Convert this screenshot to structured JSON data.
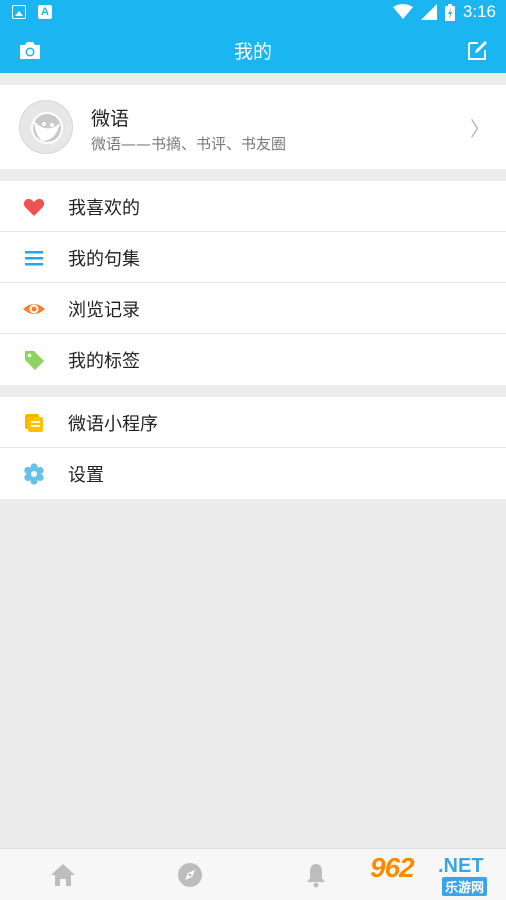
{
  "status_bar": {
    "time": "3:16"
  },
  "app_bar": {
    "title": "我的",
    "left_icon": "camera-icon",
    "right_icon": "edit-icon"
  },
  "profile": {
    "name": "微语",
    "description": "微语——书摘、书评、书友圈",
    "chevron": "〉"
  },
  "menu_group_1": {
    "items": [
      {
        "label": "我喜欢的",
        "icon": "heart-icon",
        "color": "#ef5350"
      },
      {
        "label": "我的句集",
        "icon": "list-icon",
        "color": "#1aa9ee"
      },
      {
        "label": "浏览记录",
        "icon": "eye-icon",
        "color": "#f7812b"
      },
      {
        "label": "我的标签",
        "icon": "tag-icon",
        "color": "#8dd35f"
      }
    ]
  },
  "menu_group_2": {
    "items": [
      {
        "label": "微语小程序",
        "icon": "mini-program-icon",
        "color": "#ffc107"
      },
      {
        "label": "设置",
        "icon": "settings-icon",
        "color": "#66c0ec"
      }
    ]
  },
  "tab_bar": {
    "tabs": [
      "home-icon",
      "compass-icon",
      "bell-icon"
    ]
  },
  "watermark": {
    "logo_text": "962",
    "net_text": ".NET",
    "sub_text": "乐游网"
  },
  "colors": {
    "accent": "#1bb5f2",
    "background": "#ebebeb",
    "tab_icon": "#bdbdbd"
  }
}
